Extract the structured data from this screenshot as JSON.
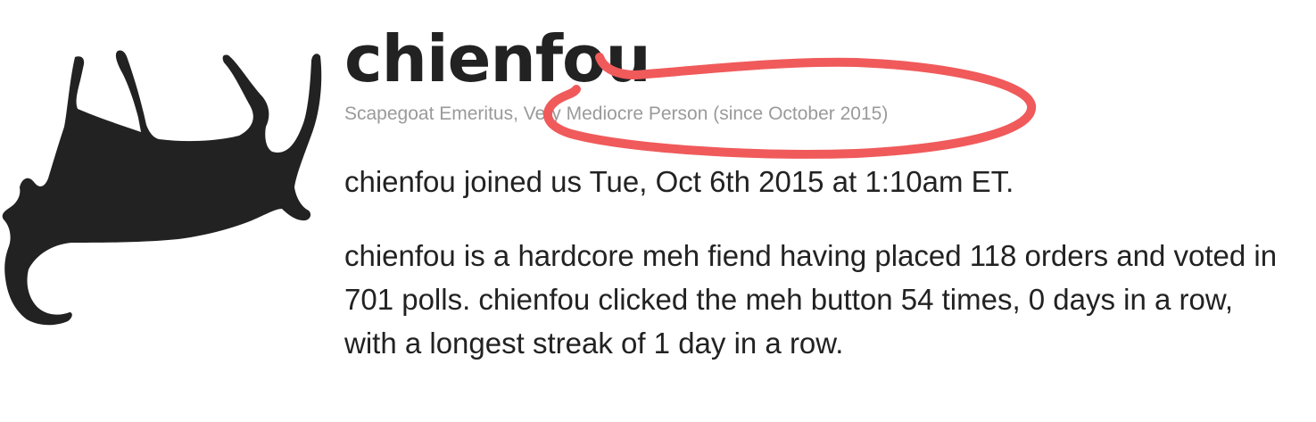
{
  "profile": {
    "username": "chienfou",
    "title_primary": "Scapegoat Emeritus",
    "title_separator": ", ",
    "title_secondary": "Very Mediocre Person (since October 2015)",
    "joined_text": "chienfou joined us Tue, Oct 6th 2015 at 1:10am ET.",
    "stats_text": "chienfou is a hardcore meh fiend having placed 118 orders and voted in 701 polls. chienfou clicked the meh button 54 times, 0 days in a row, with a longest streak of 1 day in a row."
  },
  "avatar": {
    "icon": "cat-silhouette-icon",
    "color": "#222222"
  },
  "annotation": {
    "shape": "freehand-circle",
    "color": "#f05a5b"
  }
}
